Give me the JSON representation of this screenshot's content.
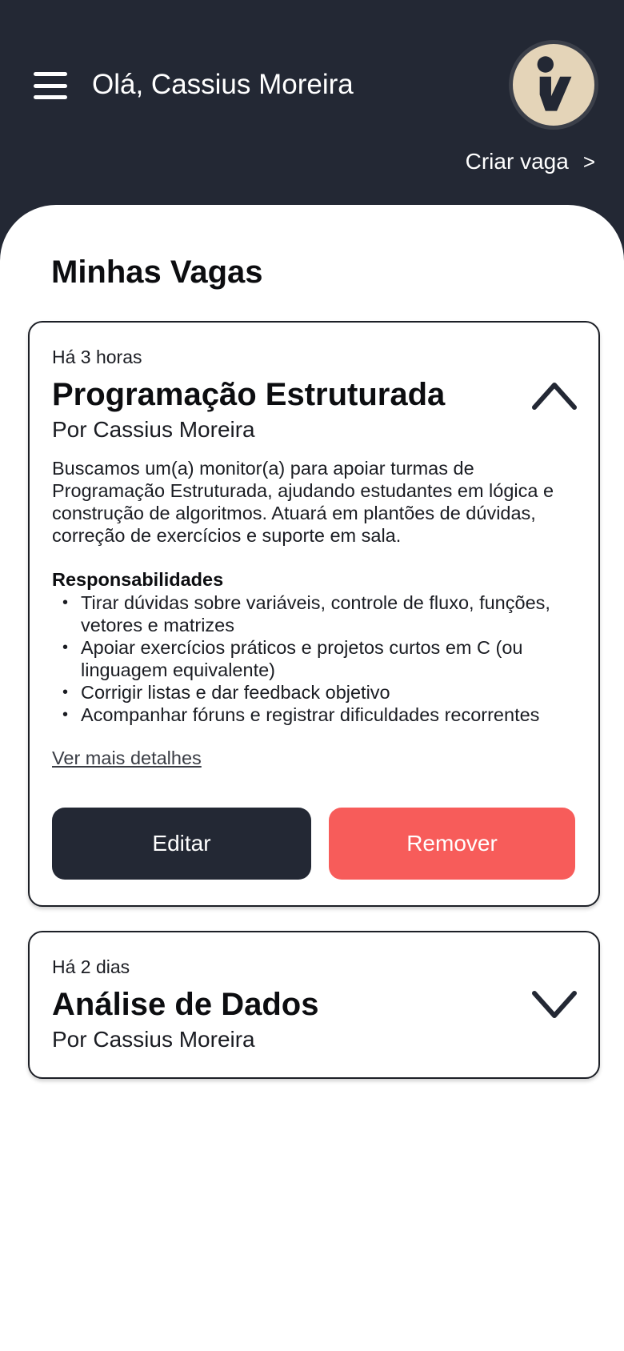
{
  "header": {
    "greeting": "Olá, Cassius Moreira",
    "create_label": "Criar vaga",
    "create_chevron": ">",
    "avatar_icon": "logo-person-icon"
  },
  "main": {
    "section_title": "Minhas Vagas",
    "jobs": [
      {
        "time": "Há 3 horas",
        "title": "Programação Estruturada",
        "author": "Por Cassius Moreira",
        "expanded": true,
        "description": "Buscamos um(a) monitor(a) para apoiar turmas de Programação Estruturada, ajudando estudantes em lógica e construção de algoritmos. Atuará em plantões de dúvidas, correção de exercícios e suporte em sala.",
        "responsibilities_title": "Responsabilidades",
        "responsibilities": [
          "Tirar dúvidas sobre variáveis, controle de fluxo, funções, vetores e matrizes",
          "Apoiar exercícios práticos e projetos curtos em C (ou linguagem equivalente)",
          "Corrigir listas e dar feedback objetivo",
          "Acompanhar fóruns e registrar dificuldades recorrentes"
        ],
        "more_label": "Ver mais detalhes",
        "edit_label": "Editar",
        "remove_label": "Remover"
      },
      {
        "time": "Há 2 dias",
        "title": "Análise de Dados",
        "author": "Por Cassius Moreira",
        "expanded": false
      }
    ]
  },
  "colors": {
    "header_bg": "#232834",
    "remove_button": "#f75c5a",
    "edit_button": "#232834",
    "avatar_bg": "#e4d4b8"
  }
}
